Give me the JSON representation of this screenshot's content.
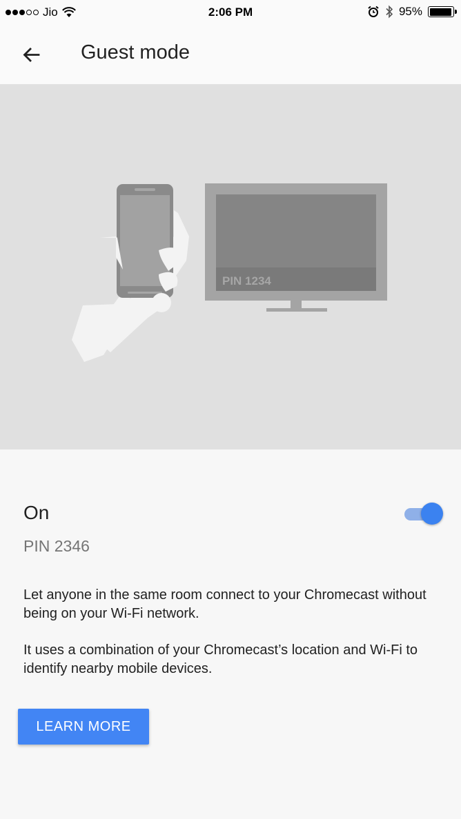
{
  "status_bar": {
    "carrier": "Jio",
    "time": "2:06 PM",
    "battery_percent": "95%",
    "battery_level": 0.95,
    "icons": [
      "signal-dots-icon",
      "wifi-icon",
      "alarm-icon",
      "bluetooth-icon",
      "battery-icon"
    ]
  },
  "app_bar": {
    "back_icon": "arrow-left-icon",
    "title": "Guest mode"
  },
  "illustration": {
    "tv_pin_label": "PIN 1234",
    "background_color": "#e0e0e0"
  },
  "guest_mode": {
    "status": "On",
    "enabled": true,
    "pin": "PIN 2346",
    "description_1": "Let anyone in the same room connect to your Chromecast without being on your Wi-Fi network.",
    "description_2": "It uses a combination of your Chromecast’s location and Wi-Fi to identify nearby mobile devices.",
    "learn_more_label": "LEARN MORE"
  },
  "colors": {
    "accent": "#4285f4",
    "toggle_thumb": "#3b82f0",
    "toggle_track": "#8fb0e8"
  }
}
